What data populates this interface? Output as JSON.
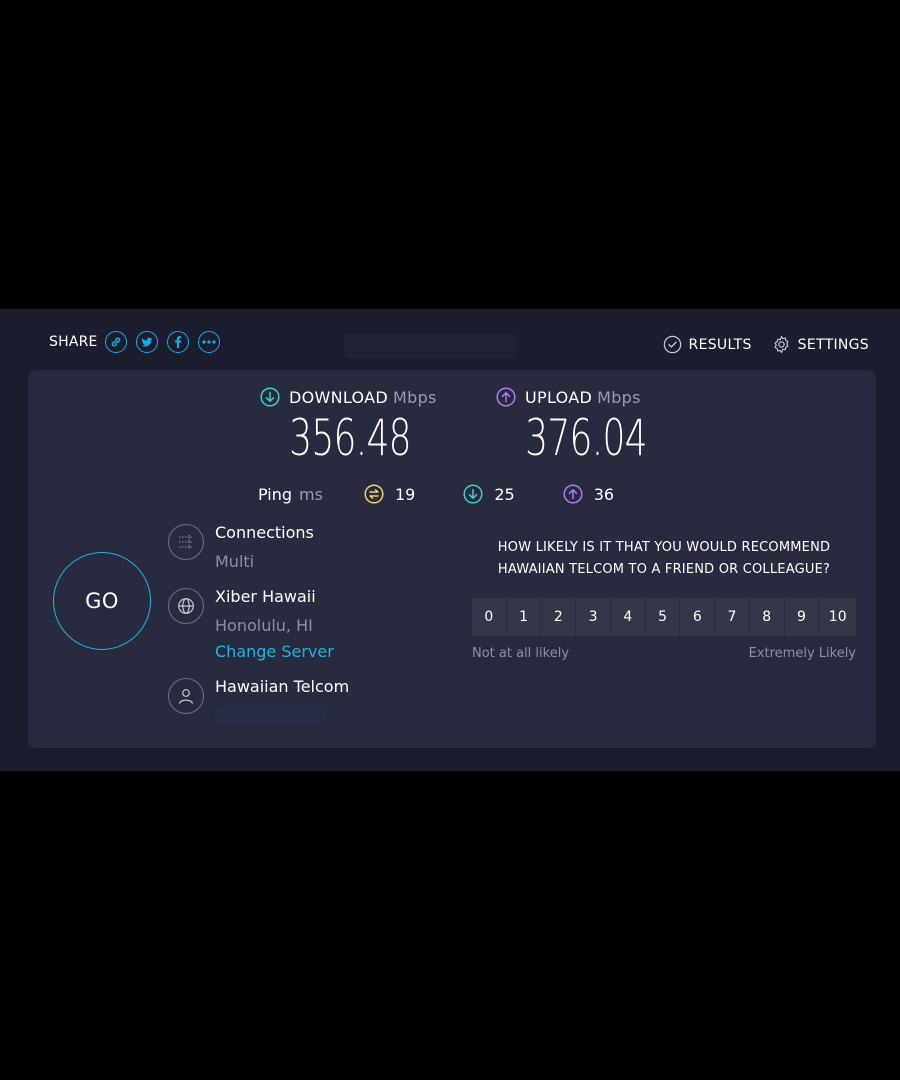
{
  "share": {
    "label": "SHARE",
    "icons": [
      "link-icon",
      "twitter-icon",
      "facebook-icon",
      "more-icon"
    ]
  },
  "nav": {
    "results": "RESULTS",
    "settings": "SETTINGS"
  },
  "download": {
    "label": "DOWNLOAD",
    "unit": "Mbps",
    "value": "356.48"
  },
  "upload": {
    "label": "UPLOAD",
    "unit": "Mbps",
    "value": "376.04"
  },
  "ping": {
    "label": "Ping",
    "unit": "ms",
    "idle": "19",
    "download": "25",
    "upload": "36"
  },
  "go": "GO",
  "connections": {
    "title": "Connections",
    "value": "Multi"
  },
  "server": {
    "name": "Xiber Hawaii",
    "location": "Honolulu, HI",
    "change": "Change Server"
  },
  "provider": {
    "name": "Hawaiian Telcom"
  },
  "survey": {
    "question_line1": "HOW LIKELY IS IT THAT YOU WOULD RECOMMEND",
    "question_line2": "HAWAIIAN TELCOM TO A FRIEND OR COLLEAGUE?",
    "scale": [
      "0",
      "1",
      "2",
      "3",
      "4",
      "5",
      "6",
      "7",
      "8",
      "9",
      "10"
    ],
    "low_label": "Not at all likely",
    "high_label": "Extremely Likely"
  },
  "colors": {
    "accent": "#1fb5e0",
    "download": "#3fd1c4",
    "upload": "#b27af0",
    "ping": "#f1d56b",
    "background": "#1c1e30",
    "panel": "#282a3f"
  }
}
